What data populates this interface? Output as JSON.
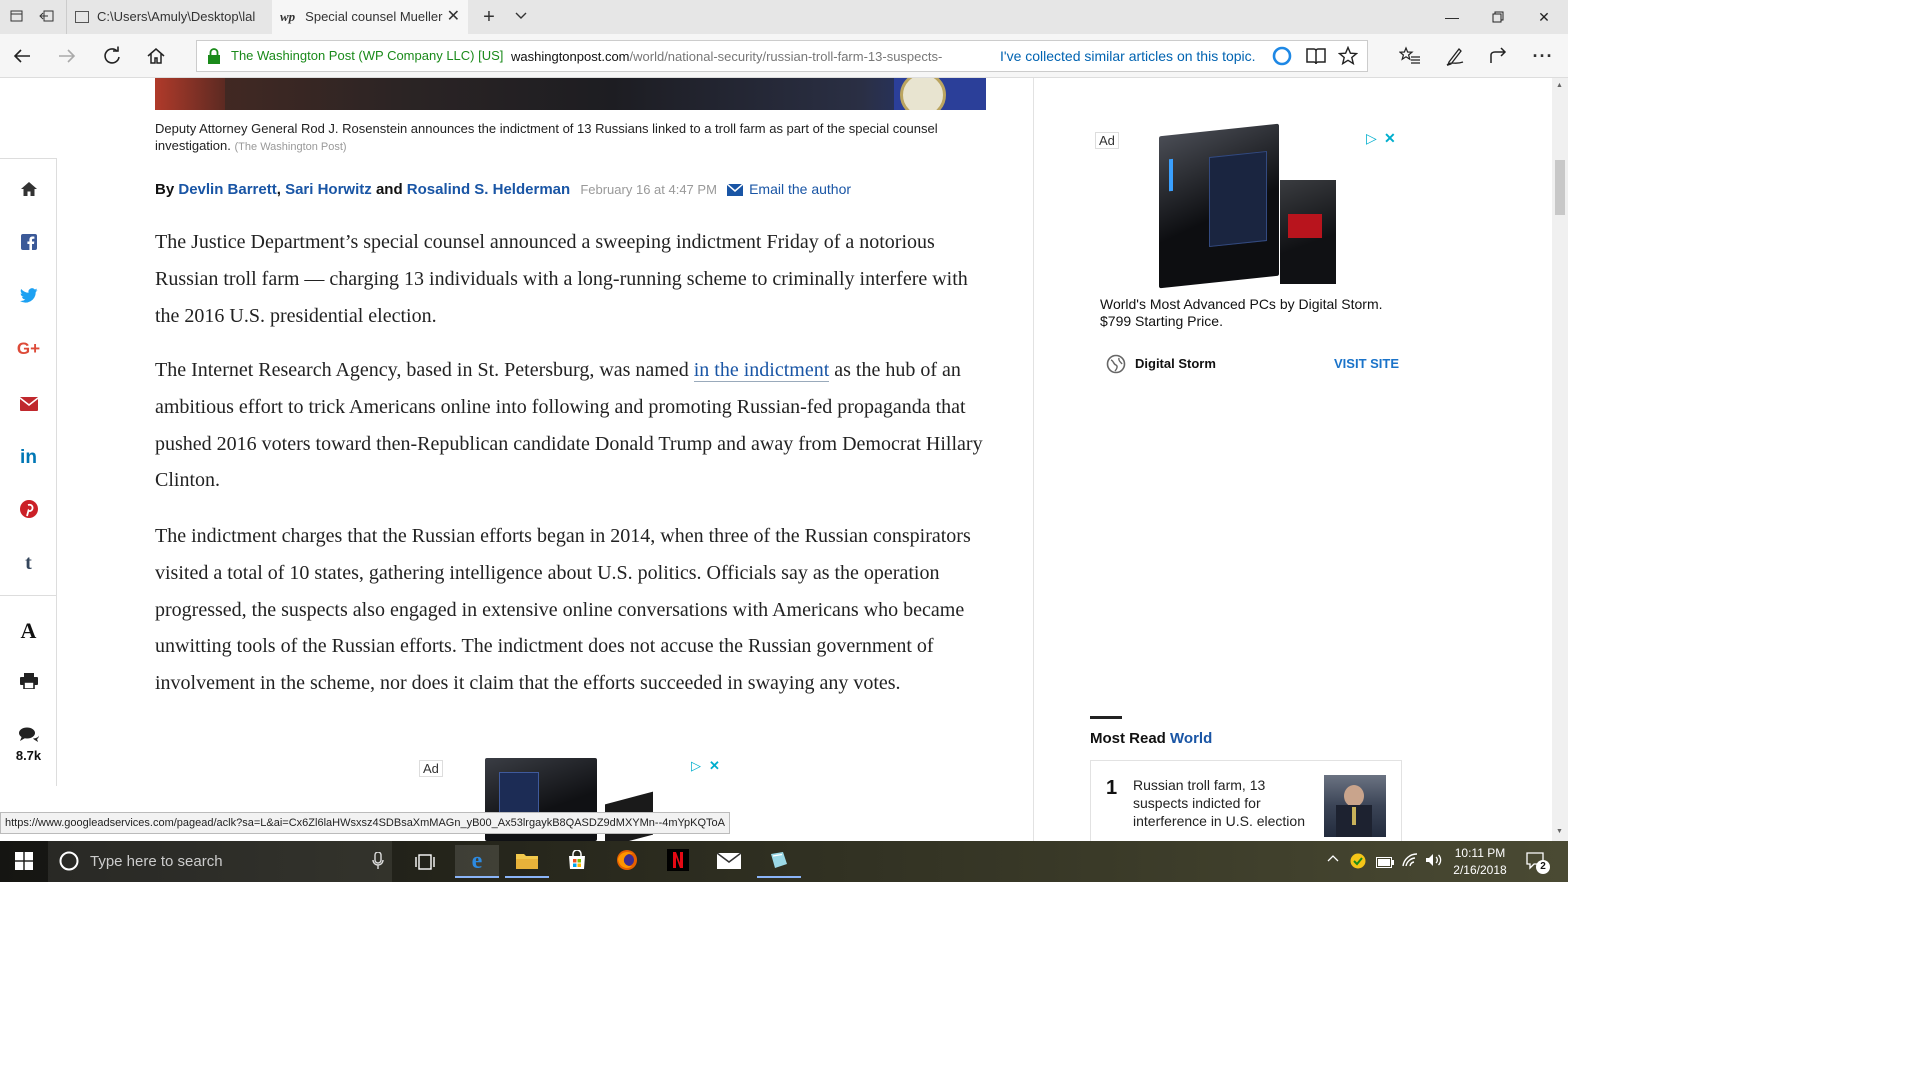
{
  "browser": {
    "tabs": [
      {
        "label": "C:\\Users\\Amuly\\Desktop\\lal",
        "active": false
      },
      {
        "favicon": "wp",
        "label": "Special counsel Mueller",
        "active": true
      }
    ],
    "site_identity": "The Washington Post (WP Company LLC) [US]",
    "url_domain": "washingtonpost.com",
    "url_path": "/world/national-security/russian-troll-farm-13-suspects-",
    "collections_hint": "I've collected similar articles on this topic."
  },
  "article": {
    "caption": "Deputy Attorney General Rod J. Rosenstein announces the indictment of 13 Russians linked to a troll farm as part of the special counsel investigation.",
    "caption_credit": "(The Washington Post)",
    "byline": {
      "by": "By",
      "author1": "Devlin Barrett",
      "sep1": ",",
      "author2": "Sari Horwitz",
      "and": "and",
      "author3": "Rosalind S. Helderman",
      "date": "February 16 at 4:47 PM",
      "email_label": "Email the author"
    },
    "p1": "The Justice Department’s special counsel announced a sweeping indictment Friday of a notorious Russian troll farm — charging 13 individuals with a long-running scheme to criminally interfere with the 2016 U.S. presidential election.",
    "p2_before": "The Internet Research Agency, based in St. Petersburg, was named ",
    "p2_link": "in the indictment",
    "p2_after": " as the hub of an ambitious effort to trick Americans online into following and promoting Russian-fed propaganda that pushed 2016 voters toward then-Republican candidate Donald Trump and away from Democrat Hillary Clinton.",
    "p3": "The indictment charges that the Russian efforts began in 2014, when three of the Russian conspirators visited a total of 10 states, gathering intelligence about U.S. politics. Officials say as the operation progressed, the suspects also engaged in extensive online conversations with Americans who became unwitting tools of the Russian efforts. The indictment does not accuse the Russian government of involvement in the scheme, nor does it claim that the efforts succeeded in swaying any votes.",
    "inline_ad_label": "Ad"
  },
  "share_rail": {
    "comments_count": "8.7k",
    "font_glyph": "A"
  },
  "sidebar": {
    "ad_label": "Ad",
    "ad_text": "World's Most Advanced PCs by Digital Storm. $799 Starting Price.",
    "advertiser": "Digital Storm",
    "cta": "VISIT SITE",
    "most_read_prefix": "Most Read",
    "most_read_section": "World",
    "most_read_items": [
      {
        "rank": "1",
        "title": "Russian troll farm, 13 suspects indicted for interference in U.S. election"
      }
    ]
  },
  "status_url": "https://www.googleadservices.com/pagead/aclk?sa=L&ai=Cx6Zl6laHWsxsz4SDBsaXmMAGn_yB00_Ax53lrgaykB8QASDZ9dMXYMn--4mYpKQToA",
  "taskbar": {
    "search_placeholder": "Type here to search",
    "time": "10:11 PM",
    "date": "2/16/2018",
    "notification_count": "2"
  },
  "colors": {
    "link_blue": "#1955a5",
    "secure_green": "#1a8a1a",
    "url_blue": "#0063b1"
  }
}
